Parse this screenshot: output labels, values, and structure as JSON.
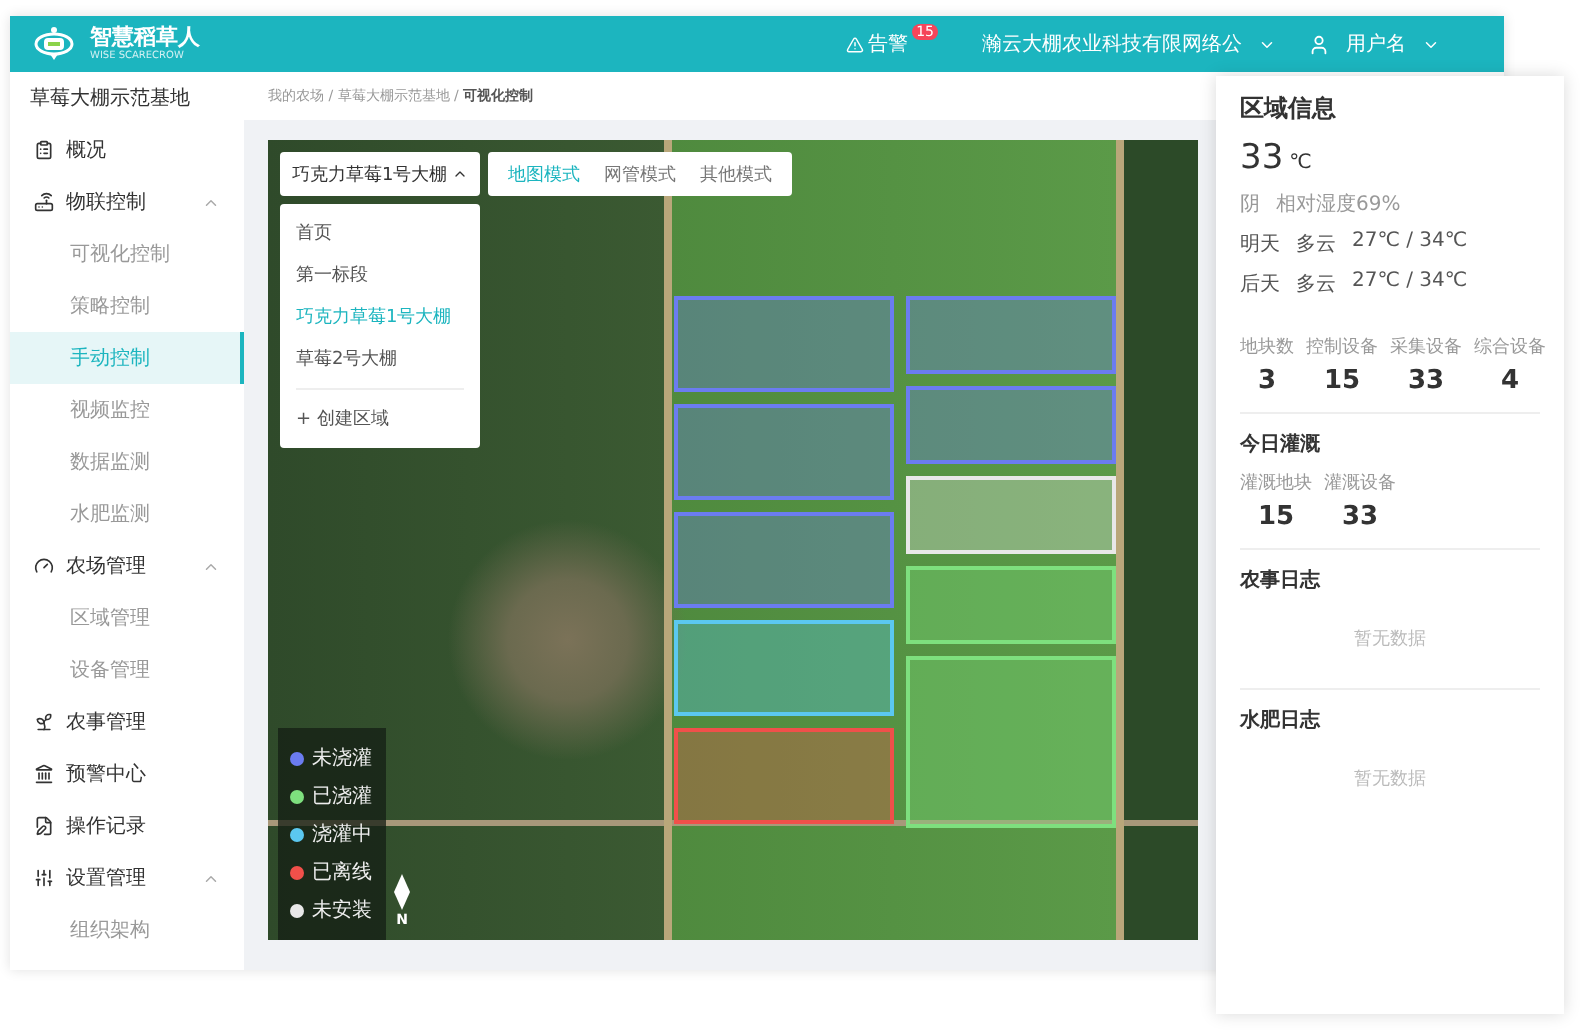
{
  "header": {
    "logo_title": "智慧稻草人",
    "logo_subtitle": "WISE SCARECROW",
    "alert_label": "告警",
    "alert_count": "15",
    "company": "瀚云大棚农业科技有限网络公",
    "user": "用户名"
  },
  "sidebar": {
    "farm": "草莓大棚示范基地",
    "items": [
      {
        "label": "概况",
        "kind": "overview"
      },
      {
        "label": "物联控制",
        "kind": "iot",
        "expanded": true,
        "children": [
          {
            "label": "可视化控制",
            "selected": false
          },
          {
            "label": "策略控制",
            "selected": false
          },
          {
            "label": "手动控制",
            "selected": true
          },
          {
            "label": "视频监控",
            "selected": false
          },
          {
            "label": "数据监测",
            "selected": false
          },
          {
            "label": "水肥监测",
            "selected": false
          }
        ]
      },
      {
        "label": "农场管理",
        "kind": "farm",
        "expanded": true,
        "children": [
          {
            "label": "区域管理",
            "selected": false
          },
          {
            "label": "设备管理",
            "selected": false
          }
        ]
      },
      {
        "label": "农事管理",
        "kind": "work"
      },
      {
        "label": "预警中心",
        "kind": "alert"
      },
      {
        "label": "操作记录",
        "kind": "log"
      },
      {
        "label": "设置管理",
        "kind": "settings",
        "expanded": true,
        "children": [
          {
            "label": "组织架构",
            "selected": false
          }
        ]
      }
    ]
  },
  "breadcrumb": "我的农场 / 草莓大棚示范基地 / **可视化控制**",
  "map": {
    "area_select": {
      "value": "巧克力草莓1号大棚",
      "expanded": true,
      "options": [
        {
          "label": "首页",
          "selected": false
        },
        {
          "label": "第一标段",
          "selected": false
        },
        {
          "label": "巧克力草莓1号大棚",
          "selected": true
        },
        {
          "label": "草莓2号大棚",
          "selected": false
        }
      ],
      "create_label": "+ 创建区域"
    },
    "modes": [
      {
        "label": "地图模式",
        "selected": true
      },
      {
        "label": "网管模式",
        "selected": false
      },
      {
        "label": "其他模式",
        "selected": false
      }
    ],
    "plot_columns": [
      [
        {
          "kind": "standard",
          "color": "#6b7cf0"
        },
        {
          "kind": "standard",
          "color": "#6b7cf0"
        },
        {
          "kind": "standard",
          "color": "#6b7cf0"
        },
        {
          "kind": "standard",
          "color": "#5bc8f0"
        },
        {
          "kind": "standard",
          "color": "#f0504a"
        }
      ],
      [
        {
          "kind": "small",
          "color": "#6b7cf0"
        },
        {
          "kind": "small",
          "color": "#6b7cf0"
        },
        {
          "kind": "small",
          "color": "#e8e8e8"
        },
        {
          "kind": "small",
          "color": "#7ee07e"
        },
        {
          "kind": "large",
          "color": "#7ee07e"
        }
      ]
    ],
    "legend": [
      {
        "label": "未浇灌",
        "color": "#6b7cf0"
      },
      {
        "label": "已浇灌",
        "color": "#7ee07e"
      },
      {
        "label": "浇灌中",
        "color": "#5bc8f0"
      },
      {
        "label": "已离线",
        "color": "#f0504a"
      },
      {
        "label": "未安装",
        "color": "#e8e8e8"
      }
    ],
    "compass_label": "N"
  },
  "panel": {
    "title": "区域信息",
    "temperature": "33",
    "unit": "℃",
    "weather": "阴",
    "humidity": "相对湿度69%",
    "forecast": [
      {
        "day": "明天",
        "weather": "多云",
        "range": "27℃ / 34℃"
      },
      {
        "day": "后天",
        "weather": "多云",
        "range": "27℃ / 34℃"
      }
    ],
    "stats": [
      {
        "label": "地块数",
        "value": "3"
      },
      {
        "label": "控制设备",
        "value": "15"
      },
      {
        "label": "采集设备",
        "value": "33"
      },
      {
        "label": "综合设备",
        "value": "4"
      }
    ],
    "irrigation_title": "今日灌溉",
    "irrigation": [
      {
        "label": "灌溉地块",
        "value": "15"
      },
      {
        "label": "灌溉设备",
        "value": "33"
      }
    ],
    "logs": [
      {
        "title": "农事日志",
        "empty": "暂无数据"
      },
      {
        "title": "水肥日志",
        "empty": "暂无数据"
      }
    ]
  }
}
